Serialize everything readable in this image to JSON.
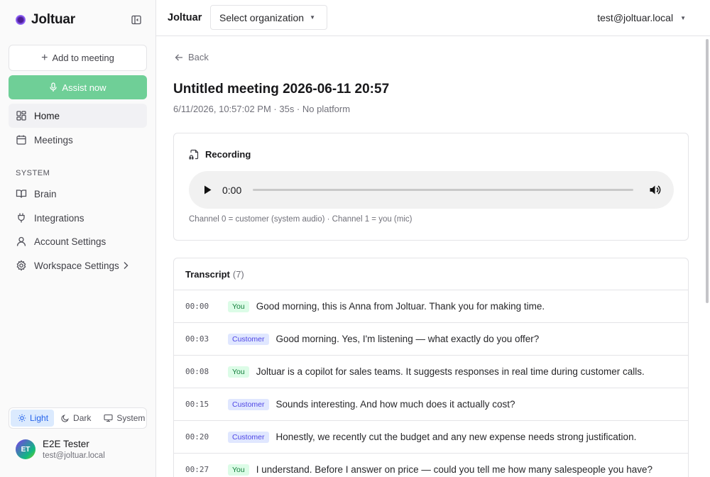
{
  "sidebar": {
    "brand": "Joltuar",
    "add_button": "Add to meeting",
    "assist_button": "Assist now",
    "nav": [
      {
        "label": "Home"
      },
      {
        "label": "Meetings"
      }
    ],
    "section_label": "SYSTEM",
    "system_nav": [
      {
        "label": "Brain"
      },
      {
        "label": "Integrations"
      },
      {
        "label": "Account Settings"
      },
      {
        "label": "Workspace Settings"
      }
    ],
    "theme": {
      "light": "Light",
      "dark": "Dark",
      "system": "System",
      "selected": "Light"
    },
    "user": {
      "initials": "ET",
      "name": "E2E Tester",
      "email": "test@joltuar.local"
    }
  },
  "header": {
    "title": "Joltuar",
    "org_select": "Select organization",
    "account": "test@joltuar.local"
  },
  "main": {
    "back": "Back",
    "title": "Untitled meeting 2026-06-11 20:57",
    "meta": "6/11/2026, 10:57:02 PM · 35s · No platform",
    "recording": {
      "heading": "Recording",
      "time": "0:00",
      "channel_note": "Channel 0 = customer (system audio) · Channel 1 = you (mic)"
    },
    "transcript": {
      "heading": "Transcript",
      "count": "(7)",
      "rows": [
        {
          "time": "00:00",
          "speaker": "You",
          "text": "Good morning, this is Anna from Joltuar. Thank you for making time."
        },
        {
          "time": "00:03",
          "speaker": "Customer",
          "text": "Good morning. Yes, I'm listening — what exactly do you offer?"
        },
        {
          "time": "00:08",
          "speaker": "You",
          "text": "Joltuar is a copilot for sales teams. It suggests responses in real time during customer calls."
        },
        {
          "time": "00:15",
          "speaker": "Customer",
          "text": "Sounds interesting. And how much does it actually cost?"
        },
        {
          "time": "00:20",
          "speaker": "Customer",
          "text": "Honestly, we recently cut the budget and any new expense needs strong justification."
        },
        {
          "time": "00:27",
          "speaker": "You",
          "text": "I understand. Before I answer on price — could you tell me how many salespeople you have?"
        }
      ]
    }
  },
  "colors": {
    "assist_green": "#6fcf97",
    "you_badge": "#dcfce7",
    "customer_badge": "#e0e7ff",
    "theme_active": "#dbeafe"
  }
}
